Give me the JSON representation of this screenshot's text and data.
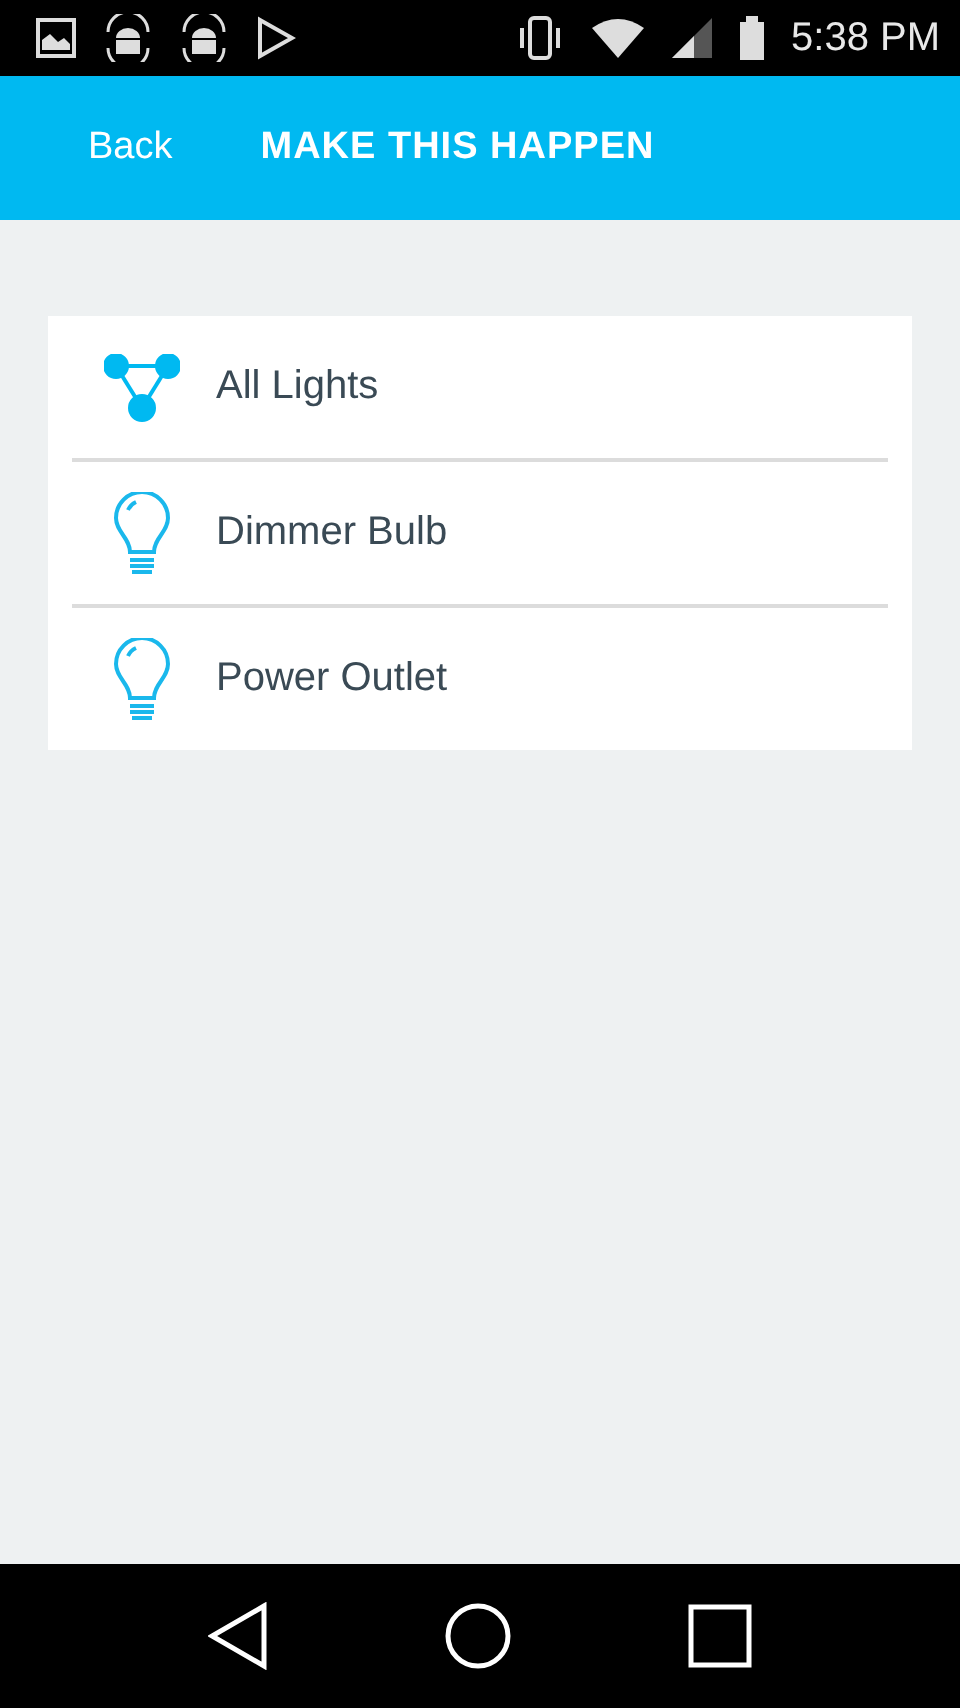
{
  "status_bar": {
    "time": "5:38 PM"
  },
  "header": {
    "back": "Back",
    "title": "MAKE THIS HAPPEN"
  },
  "items": [
    {
      "kind": "group",
      "label": "All Lights"
    },
    {
      "kind": "bulb",
      "label": "Dimmer Bulb"
    },
    {
      "kind": "bulb",
      "label": "Power Outlet"
    }
  ]
}
